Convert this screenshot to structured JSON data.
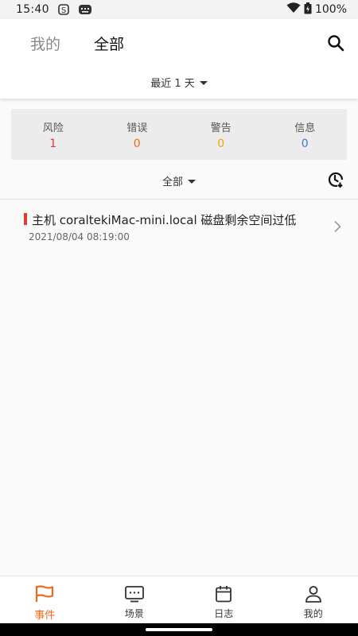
{
  "status_bar": {
    "time": "15:40",
    "battery": "100%",
    "icons": [
      "sync-icon",
      "keyboard-icon",
      "wifi-icon",
      "battery-icon"
    ]
  },
  "header": {
    "tabs": [
      {
        "label": "我的",
        "active": false
      },
      {
        "label": "全部",
        "active": true
      }
    ],
    "search_icon": "search-icon",
    "time_range": "最近 1 天"
  },
  "stats": [
    {
      "label": "风险",
      "value": "1",
      "color": "#e53935"
    },
    {
      "label": "错误",
      "value": "0",
      "color": "#ee6a1a"
    },
    {
      "label": "警告",
      "value": "0",
      "color": "#f2a40d"
    },
    {
      "label": "信息",
      "value": "0",
      "color": "#3a7bd5"
    }
  ],
  "filter": {
    "label": "全部",
    "history_icon": "history-icon"
  },
  "events": [
    {
      "title": "主机 coraltekiMac-mini.local 磁盘剩余空间过低",
      "time": "2021/08/04 08:19:00",
      "level_color": "#e53935"
    }
  ],
  "bottom_nav": [
    {
      "label": "事件",
      "icon": "flag-icon",
      "active": true
    },
    {
      "label": "场景",
      "icon": "monitor-icon",
      "active": false
    },
    {
      "label": "日志",
      "icon": "calendar-icon",
      "active": false
    },
    {
      "label": "我的",
      "icon": "person-icon",
      "active": false
    }
  ],
  "colors": {
    "accent": "#ee6a1a",
    "risk": "#e53935"
  }
}
